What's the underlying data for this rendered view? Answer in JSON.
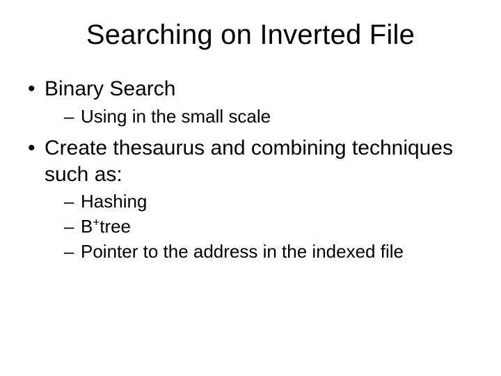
{
  "title": "Searching on Inverted File",
  "bullets": [
    {
      "text": "Binary Search",
      "sub": [
        {
          "text": "Using in the small scale"
        }
      ]
    },
    {
      "text": "Create thesaurus and combining techniques such as:",
      "sub": [
        {
          "text": "Hashing"
        },
        {
          "prefix": "B",
          "sup": "+",
          "suffix": "tree"
        },
        {
          "text": "Pointer to the address in the indexed file"
        }
      ]
    }
  ]
}
